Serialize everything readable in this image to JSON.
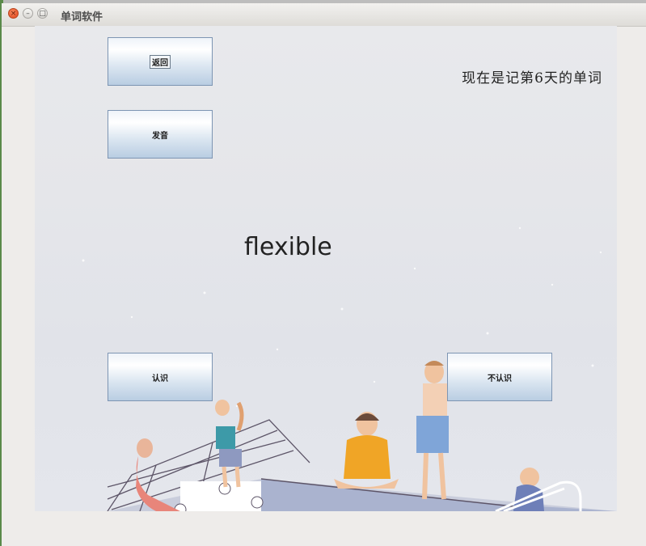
{
  "window": {
    "title": "单词软件"
  },
  "buttons": {
    "back": "返回",
    "pronounce": "发音",
    "know": "认识",
    "dont_know": "不认识"
  },
  "status": {
    "day_text": "现在是记第6天的单词"
  },
  "current_word": "flexible",
  "colors": {
    "button_gradient_top": "#ffffff",
    "button_gradient_bottom": "#b9cde2",
    "button_border": "#7d95b3",
    "background": "#e6e7eb"
  }
}
